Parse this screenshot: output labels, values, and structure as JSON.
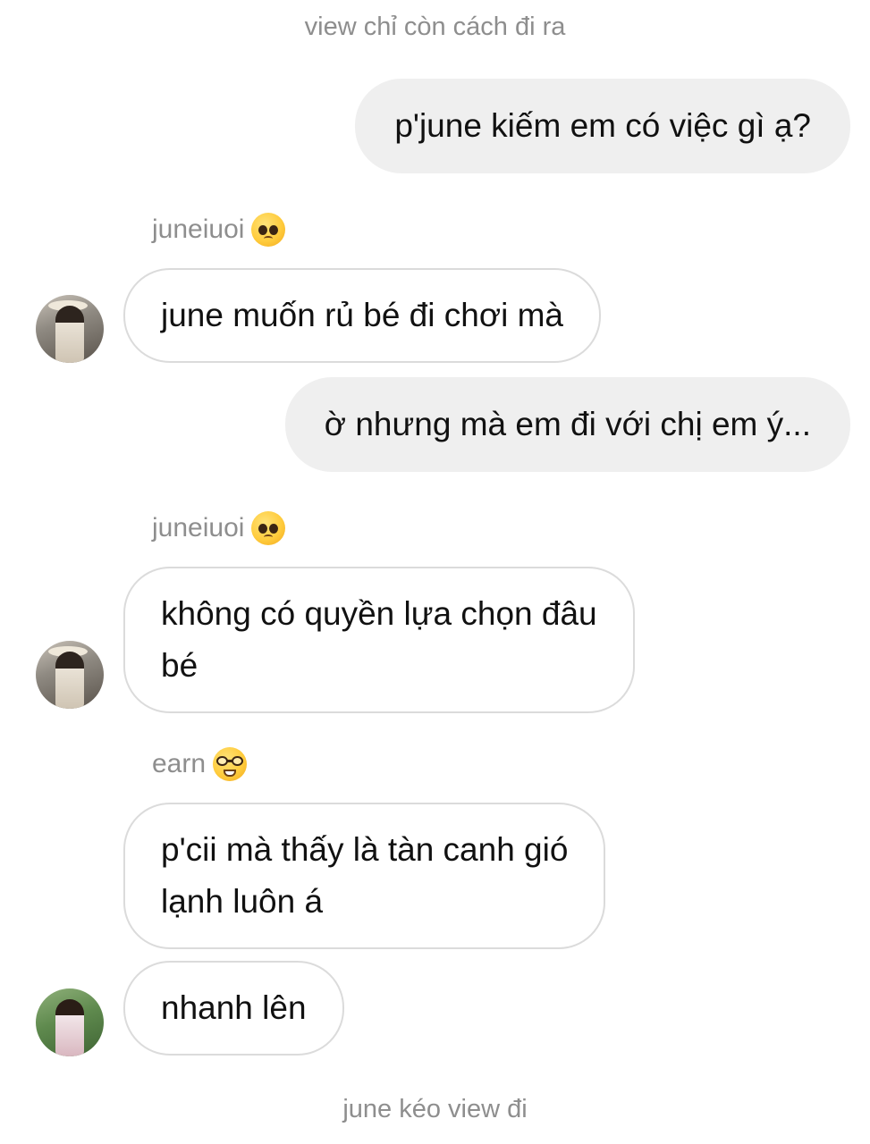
{
  "notes": {
    "top": "view chỉ còn cách đi ra",
    "bottom": "june kéo view đi"
  },
  "messages": [
    {
      "direction": "outgoing",
      "text": "p'june kiếm em có việc gì ạ?"
    },
    {
      "direction": "incoming",
      "sender": "juneiuoi",
      "sender_emoji": "pleading-face-icon",
      "text": "june muốn rủ bé đi chơi mà"
    },
    {
      "direction": "outgoing",
      "text": "ờ nhưng mà em đi với chị em ý..."
    },
    {
      "direction": "incoming",
      "sender": "juneiuoi",
      "sender_emoji": "pleading-face-icon",
      "text": "không có quyền lựa chọn đâu\nbé"
    },
    {
      "direction": "incoming",
      "sender": "earn",
      "sender_emoji": "nerd-face-icon",
      "text": "p'cii mà thấy là tàn canh gió\nlạnh luôn á"
    },
    {
      "direction": "incoming",
      "text": "nhanh lên"
    }
  ],
  "colors": {
    "outgoing_bubble": "#efefef",
    "incoming_border": "#dbdbdb",
    "meta_text": "#8e8e8e"
  }
}
